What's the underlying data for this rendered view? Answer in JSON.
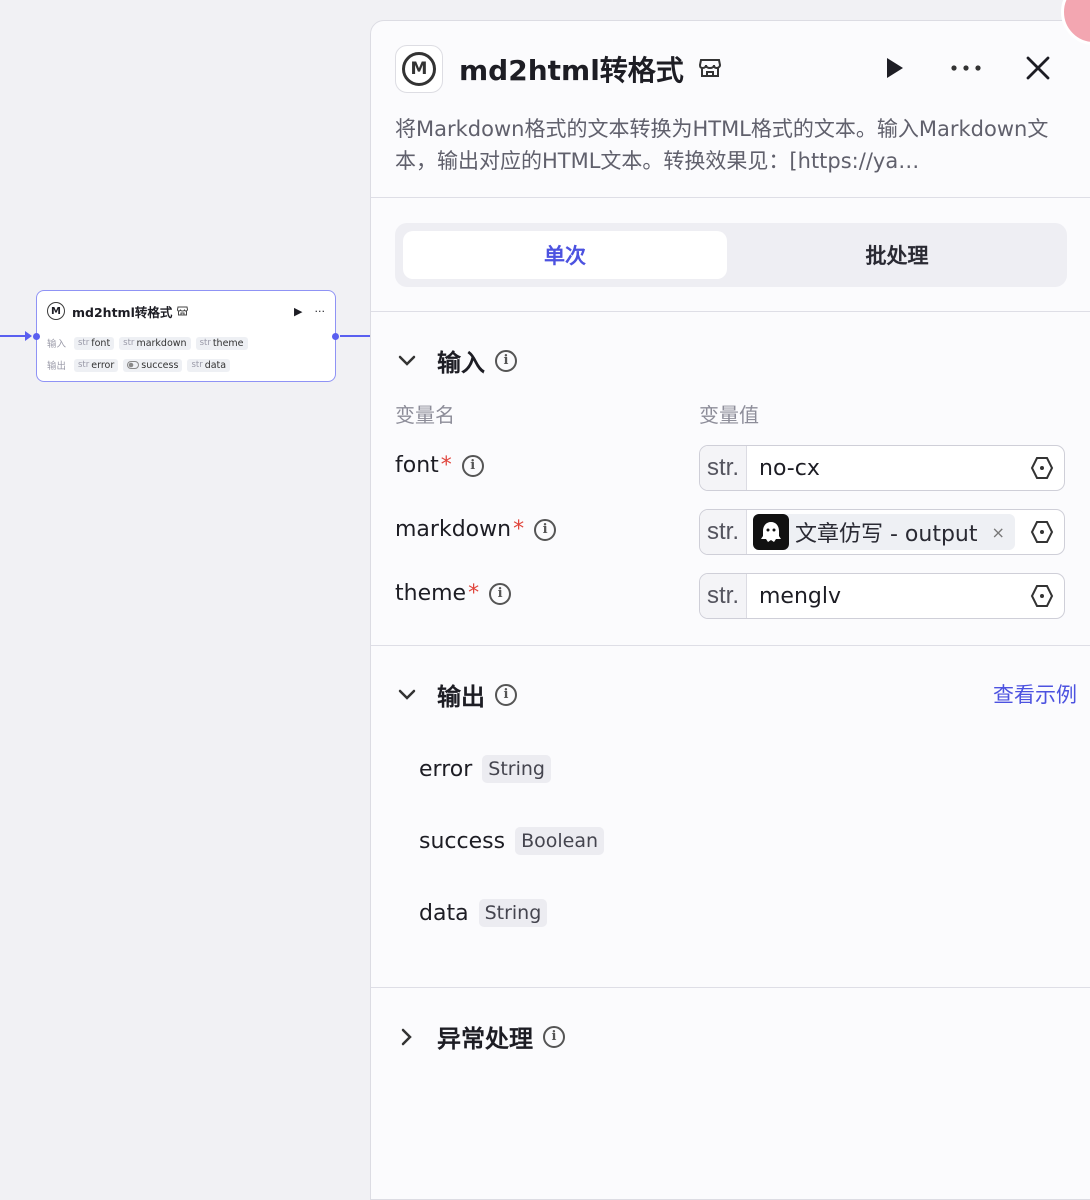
{
  "node": {
    "title": "md2html转格式",
    "logo_letter": "M",
    "inputs_label": "输入",
    "outputs_label": "输出",
    "inputs": [
      {
        "type": "str",
        "name": "font"
      },
      {
        "type": "str",
        "name": "markdown"
      },
      {
        "type": "str",
        "name": "theme"
      }
    ],
    "outputs": [
      {
        "type": "str",
        "name": "error"
      },
      {
        "type": "bool",
        "name": "success"
      },
      {
        "type": "str",
        "name": "data"
      }
    ],
    "run_glyph": "▶",
    "more_glyph": "···"
  },
  "panel": {
    "title": "md2html转格式",
    "description": "将Markdown格式的文本转换为HTML格式的文本。输入Markdown文本，输出对应的HTML文本。转换效果见：[https://ya…",
    "tabs": [
      "单次",
      "批处理"
    ],
    "input_section": {
      "title": "输入",
      "col_name": "变量名",
      "col_value": "变量值",
      "rows": [
        {
          "name": "font",
          "required": "*",
          "type": "str.",
          "value": "no-cx"
        },
        {
          "name": "markdown",
          "required": "*",
          "type": "str.",
          "ref_label": "文章仿写 - output",
          "ref_remove": "×"
        },
        {
          "name": "theme",
          "required": "*",
          "type": "str.",
          "value": "menglv"
        }
      ]
    },
    "output_section": {
      "title": "输出",
      "example_link": "查看示例",
      "rows": [
        {
          "name": "error",
          "type": "String"
        },
        {
          "name": "success",
          "type": "Boolean"
        },
        {
          "name": "data",
          "type": "String"
        }
      ]
    },
    "exception_section": {
      "title": "异常处理"
    }
  },
  "colors": {
    "accent": "#4c52e0",
    "required": "#e0453c",
    "node_border": "#8f93f5"
  }
}
